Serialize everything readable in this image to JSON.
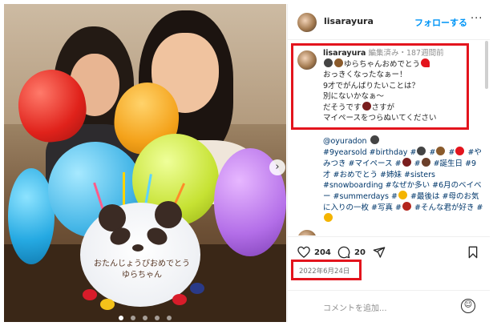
{
  "post": {
    "username": "lisarayura",
    "follow_label": "フォローする",
    "more_label": "···",
    "next_label": "›"
  },
  "caption": {
    "username": "lisarayura",
    "meta": "編集済み・187週間前",
    "lines": [
      "ゆらちゃんおめでとう",
      "おっきくなったなぁー！",
      "9才でがんばりたいことは？",
      "別にないかなぁ〜",
      "だそうです",
      "さすが",
      "マイペースをつらぬいてください"
    ]
  },
  "hashtags": {
    "mention": "@oyuradon",
    "tags": [
      "#9yearsold",
      "#birthday",
      "#",
      "#",
      "#",
      "#やみつき",
      "#マイペース",
      "#",
      "#",
      "#誕生日",
      "#9才",
      "#おめでとう",
      "#姉妹",
      "#sisters",
      "#snowboarding",
      "#なぜか多い",
      "#6月のベイベー",
      "#summerdays",
      "#",
      "#最後は",
      "#母のお気に入りの一枚",
      "#写真",
      "#",
      "#そんな君が好き",
      "#"
    ]
  },
  "actions": {
    "likes": "204",
    "comments": "20"
  },
  "date": "2022年6月24日",
  "comment": {
    "placeholder": "コメントを追加..."
  },
  "cake": {
    "text_line1": "おたんじょうびおめでとう",
    "text_line2": "ゆらちゃん"
  },
  "colors": {
    "accent": "#0095f6",
    "highlight": "#e3141d",
    "hashtag": "#00376b"
  },
  "icons": [
    "heart-icon",
    "comment-icon",
    "share-icon",
    "bookmark-icon",
    "emoji-icon"
  ]
}
